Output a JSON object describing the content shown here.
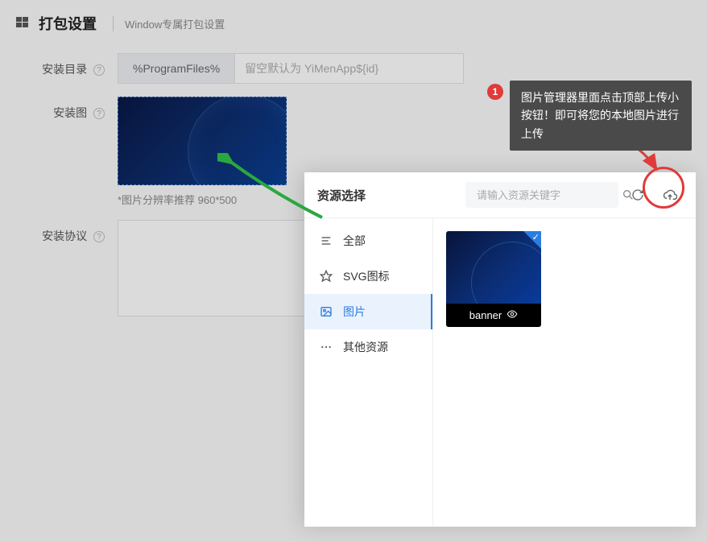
{
  "header": {
    "title": "打包设置",
    "subtitle": "Window专属打包设置"
  },
  "form": {
    "install_dir": {
      "label": "安装目录",
      "prefix": "%ProgramFiles%",
      "placeholder": "留空默认为 YiMenApp${id}"
    },
    "install_image": {
      "label": "安装图",
      "hint": "*图片分辨率推荐 960*500"
    },
    "install_agreement": {
      "label": "安装协议"
    }
  },
  "resource_panel": {
    "title": "资源选择",
    "search_placeholder": "请输入资源关键字",
    "categories": {
      "all": "全部",
      "svg": "SVG图标",
      "image": "图片",
      "other": "其他资源"
    },
    "assets": [
      {
        "name": "banner",
        "selected": true
      }
    ]
  },
  "tooltip": {
    "step": "1",
    "text": "图片管理器里面点击顶部上传小按钮！即可将您的本地图片进行上传"
  }
}
